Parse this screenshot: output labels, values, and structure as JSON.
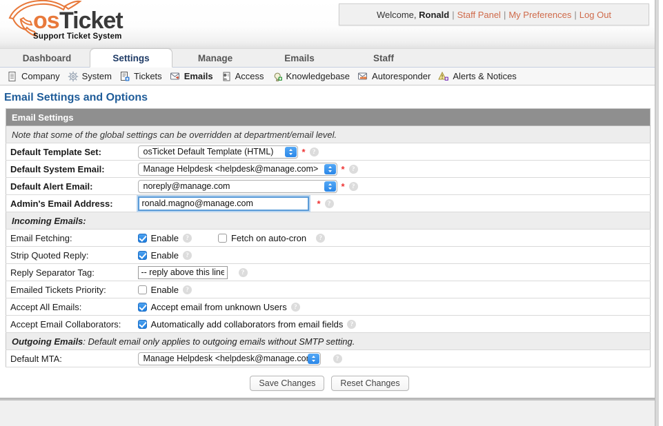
{
  "brand": {
    "name_os": "os",
    "name_ticket": "Ticket",
    "tagline": "Support Ticket System",
    "orange": "#e8793b",
    "dark": "#3a3a3a"
  },
  "welcome": {
    "greeting": "Welcome,",
    "username": "Ronald",
    "staff_panel": "Staff Panel",
    "my_preferences": "My Preferences",
    "log_out": "Log Out",
    "separator": "|",
    "link_color": "#cf6a4a"
  },
  "tabs": [
    {
      "label": "Dashboard",
      "active": false
    },
    {
      "label": "Settings",
      "active": true
    },
    {
      "label": "Manage",
      "active": false
    },
    {
      "label": "Emails",
      "active": false
    },
    {
      "label": "Staff",
      "active": false
    }
  ],
  "subnav": [
    {
      "label": "Company",
      "icon": "document-icon",
      "active": false
    },
    {
      "label": "System",
      "icon": "gear-icon",
      "active": false
    },
    {
      "label": "Tickets",
      "icon": "ticket-document-icon",
      "active": false
    },
    {
      "label": "Emails",
      "icon": "envelope-icon",
      "active": true
    },
    {
      "label": "Access",
      "icon": "user-card-icon",
      "active": false
    },
    {
      "label": "Knowledgebase",
      "icon": "lightbulb-icon",
      "active": false
    },
    {
      "label": "Autoresponder",
      "icon": "envelope-arrow-icon",
      "active": false
    },
    {
      "label": "Alerts & Notices",
      "icon": "warning-triangle-icon",
      "active": false
    }
  ],
  "page": {
    "title": "Email Settings and Options",
    "title_color": "#1f5c99"
  },
  "panel": {
    "header": "Email Settings",
    "note": "Note that some of the global settings can be overridden at department/email level."
  },
  "fields": {
    "default_template_set": {
      "label": "Default Template Set:",
      "value": "osTicket Default Template (HTML)",
      "required": "*"
    },
    "default_system_email": {
      "label": "Default System Email:",
      "value": "Manage Helpdesk <helpdesk@manage.com>",
      "required": "*"
    },
    "default_alert_email": {
      "label": "Default Alert Email:",
      "value": "noreply@manage.com",
      "required": "*"
    },
    "admin_email_address": {
      "label": "Admin's Email Address:",
      "value": "ronald.magno@manage.com",
      "required": "*"
    }
  },
  "incoming": {
    "section_label": "Incoming Emails:",
    "email_fetching": {
      "label": "Email Fetching:",
      "enable_label": "Enable",
      "enable_checked": true,
      "cron_label": "Fetch on auto-cron",
      "cron_checked": false
    },
    "strip_quoted_reply": {
      "label": "Strip Quoted Reply:",
      "enable_label": "Enable",
      "enable_checked": true
    },
    "reply_separator_tag": {
      "label": "Reply Separator Tag:",
      "value": "-- reply above this line -"
    },
    "emailed_tickets_priority": {
      "label": "Emailed Tickets Priority:",
      "enable_label": "Enable",
      "enable_checked": false
    },
    "accept_all_emails": {
      "label": "Accept All Emails:",
      "option_label": "Accept email from unknown Users",
      "checked": true
    },
    "accept_email_collaborators": {
      "label": "Accept Email Collaborators:",
      "option_label": "Automatically add collaborators from email fields",
      "checked": true
    }
  },
  "outgoing": {
    "section_bold": "Outgoing Emails",
    "section_rest": ": Default email only applies to outgoing emails without SMTP setting.",
    "default_mta": {
      "label": "Default MTA:",
      "value": "Manage Helpdesk <helpdesk@manage.com>"
    }
  },
  "actions": {
    "save": "Save Changes",
    "reset": "Reset Changes"
  },
  "icons": {
    "help": "?"
  }
}
